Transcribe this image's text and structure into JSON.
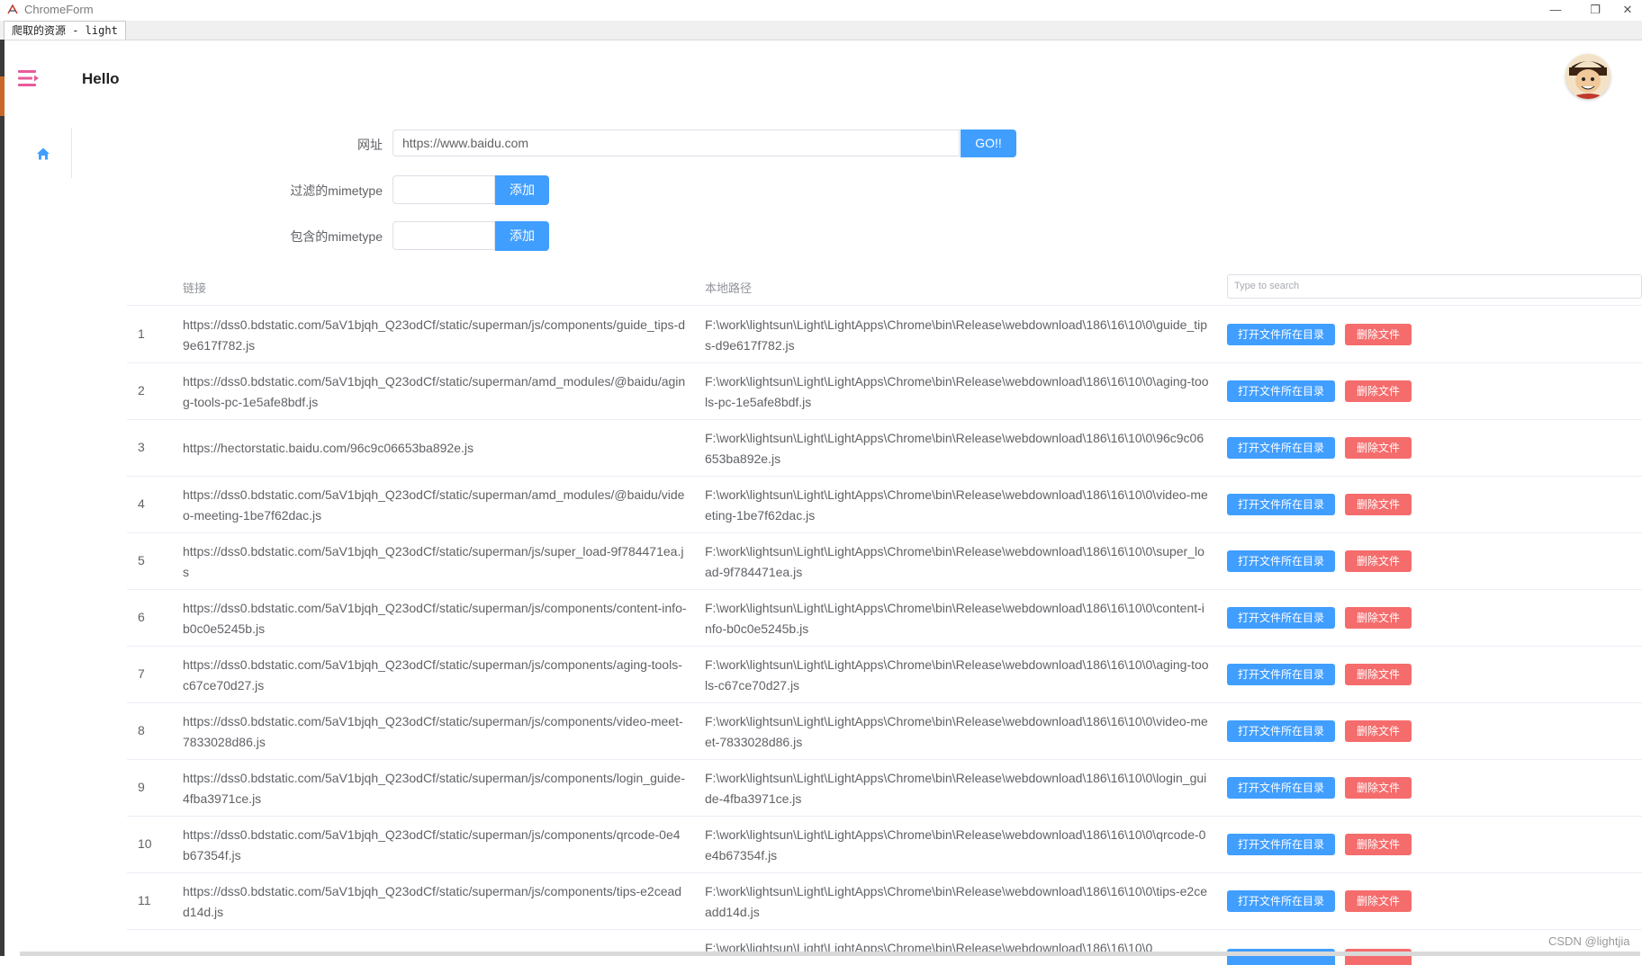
{
  "window": {
    "title": "ChromeForm",
    "tab_label": "爬取的资源 - light",
    "minimize": "—",
    "restore": "❐",
    "close": "✕"
  },
  "header": {
    "title": "Hello"
  },
  "form": {
    "url_label": "网址",
    "url_value": "https://www.baidu.com",
    "go_label": "GO!!",
    "filter_label": "过滤的mimetype",
    "filter_add_label": "添加",
    "include_label": "包含的mimetype",
    "include_add_label": "添加"
  },
  "table": {
    "col_link": "链接",
    "col_path": "本地路径",
    "search_placeholder": "Type to search",
    "open_label": "打开文件所在目录",
    "delete_label": "删除文件",
    "rows": [
      {
        "index": "1",
        "link": "https://dss0.bdstatic.com/5aV1bjqh_Q23odCf/static/superman/js/components/guide_tips-d9e617f782.js",
        "path": "F:\\work\\lightsun\\Light\\LightApps\\Chrome\\bin\\Release\\webdownload\\186\\16\\10\\0\\guide_tips-d9e617f782.js"
      },
      {
        "index": "2",
        "link": "https://dss0.bdstatic.com/5aV1bjqh_Q23odCf/static/superman/amd_modules/@baidu/aging-tools-pc-1e5afe8bdf.js",
        "path": "F:\\work\\lightsun\\Light\\LightApps\\Chrome\\bin\\Release\\webdownload\\186\\16\\10\\0\\aging-tools-pc-1e5afe8bdf.js"
      },
      {
        "index": "3",
        "link": "https://hectorstatic.baidu.com/96c9c06653ba892e.js",
        "path": "F:\\work\\lightsun\\Light\\LightApps\\Chrome\\bin\\Release\\webdownload\\186\\16\\10\\0\\96c9c06653ba892e.js"
      },
      {
        "index": "4",
        "link": "https://dss0.bdstatic.com/5aV1bjqh_Q23odCf/static/superman/amd_modules/@baidu/video-meeting-1be7f62dac.js",
        "path": "F:\\work\\lightsun\\Light\\LightApps\\Chrome\\bin\\Release\\webdownload\\186\\16\\10\\0\\video-meeting-1be7f62dac.js"
      },
      {
        "index": "5",
        "link": "https://dss0.bdstatic.com/5aV1bjqh_Q23odCf/static/superman/js/super_load-9f784471ea.js",
        "path": "F:\\work\\lightsun\\Light\\LightApps\\Chrome\\bin\\Release\\webdownload\\186\\16\\10\\0\\super_load-9f784471ea.js"
      },
      {
        "index": "6",
        "link": "https://dss0.bdstatic.com/5aV1bjqh_Q23odCf/static/superman/js/components/content-info-b0c0e5245b.js",
        "path": "F:\\work\\lightsun\\Light\\LightApps\\Chrome\\bin\\Release\\webdownload\\186\\16\\10\\0\\content-info-b0c0e5245b.js"
      },
      {
        "index": "7",
        "link": "https://dss0.bdstatic.com/5aV1bjqh_Q23odCf/static/superman/js/components/aging-tools-c67ce70d27.js",
        "path": "F:\\work\\lightsun\\Light\\LightApps\\Chrome\\bin\\Release\\webdownload\\186\\16\\10\\0\\aging-tools-c67ce70d27.js"
      },
      {
        "index": "8",
        "link": "https://dss0.bdstatic.com/5aV1bjqh_Q23odCf/static/superman/js/components/video-meet-7833028d86.js",
        "path": "F:\\work\\lightsun\\Light\\LightApps\\Chrome\\bin\\Release\\webdownload\\186\\16\\10\\0\\video-meet-7833028d86.js"
      },
      {
        "index": "9",
        "link": "https://dss0.bdstatic.com/5aV1bjqh_Q23odCf/static/superman/js/components/login_guide-4fba3971ce.js",
        "path": "F:\\work\\lightsun\\Light\\LightApps\\Chrome\\bin\\Release\\webdownload\\186\\16\\10\\0\\login_guide-4fba3971ce.js"
      },
      {
        "index": "10",
        "link": "https://dss0.bdstatic.com/5aV1bjqh_Q23odCf/static/superman/js/components/qrcode-0e4b67354f.js",
        "path": "F:\\work\\lightsun\\Light\\LightApps\\Chrome\\bin\\Release\\webdownload\\186\\16\\10\\0\\qrcode-0e4b67354f.js"
      },
      {
        "index": "11",
        "link": "https://dss0.bdstatic.com/5aV1bjqh_Q23odCf/static/superman/js/components/tips-e2ceadd14d.js",
        "path": "F:\\work\\lightsun\\Light\\LightApps\\Chrome\\bin\\Release\\webdownload\\186\\16\\10\\0\\tips-e2ceadd14d.js"
      }
    ],
    "partial_row_path": "F:\\work\\lightsun\\Light\\LightApps\\Chrome\\bin\\Release\\webdownload\\186\\16\\10\\0"
  },
  "watermark": "CSDN @lightjia",
  "colors": {
    "primary": "#409eff",
    "danger": "#f56c6c",
    "menu_icon": "#e85a9b",
    "home_icon": "#409eff"
  },
  "icons": {
    "menu": "menu-icon",
    "home": "home-icon",
    "avatar": "avatar"
  }
}
